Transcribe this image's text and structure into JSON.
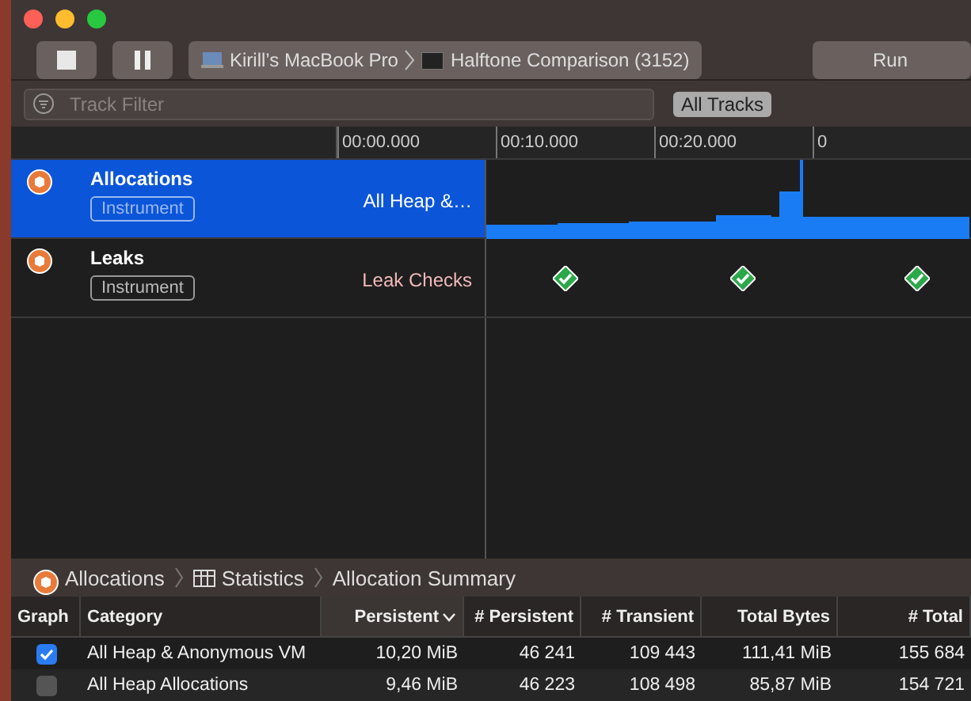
{
  "toolbar": {
    "device": "Kirill’s MacBook Pro",
    "target": "Halftone Comparison (3152)",
    "run_button": "Run"
  },
  "filter": {
    "placeholder": "Track Filter",
    "scope_button": "All Tracks"
  },
  "ruler": {
    "ticks": [
      "00:00.000",
      "00:10.000",
      "00:20.000",
      "0"
    ]
  },
  "tracks": [
    {
      "name": "Allocations",
      "tag": "Instrument",
      "detail": "All Heap &…",
      "selected": true,
      "kind": "allocations"
    },
    {
      "name": "Leaks",
      "tag": "Instrument",
      "detail": "Leak Checks",
      "selected": false,
      "kind": "leaks"
    }
  ],
  "breadcrumbs": [
    "Allocations",
    "Statistics",
    "Allocation Summary"
  ],
  "table": {
    "columns": [
      {
        "label": "Graph",
        "sorted": false
      },
      {
        "label": "Category",
        "sorted": false
      },
      {
        "label": "Persistent",
        "sorted": true
      },
      {
        "label": "# Persistent",
        "sorted": false
      },
      {
        "label": "# Transient",
        "sorted": false
      },
      {
        "label": "Total Bytes",
        "sorted": false
      },
      {
        "label": "# Total",
        "sorted": false
      }
    ],
    "rows": [
      {
        "checked": true,
        "cells": [
          "",
          "All Heap & Anonymous VM",
          "10,20 MiB",
          "46 241",
          "109 443",
          "111,41 MiB",
          "155 684"
        ]
      },
      {
        "checked": false,
        "cells": [
          "",
          "All Heap Allocations",
          "9,46 MiB",
          "46 223",
          "108 498",
          "85,87 MiB",
          "154 721"
        ]
      }
    ]
  }
}
